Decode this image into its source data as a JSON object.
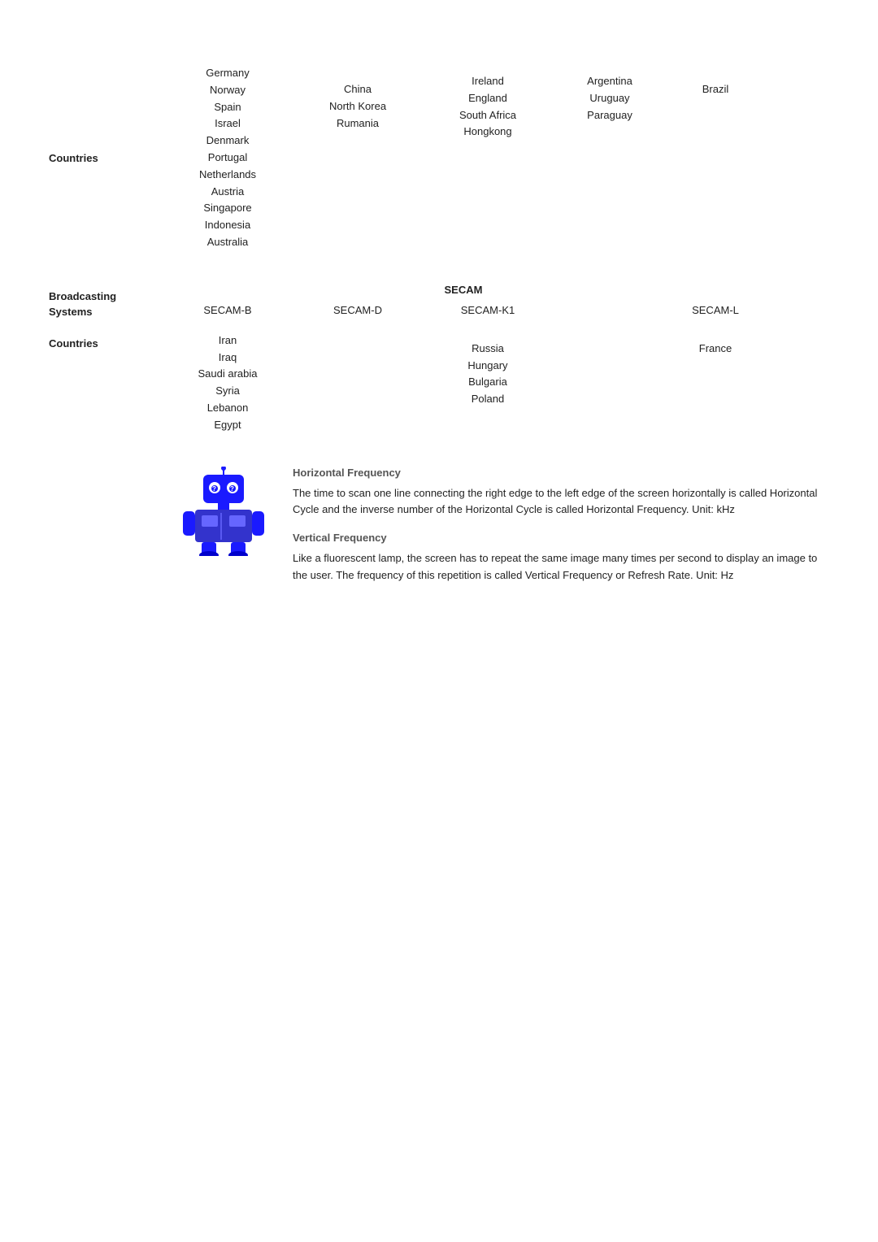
{
  "pal_section": {
    "countries_label": "Countries",
    "col1_countries": "Germany\nNorway\nSpain\nIsrael\nDenmark\nPortugal\nNetherlands\nAustria\nSingapore\nIndonesia\nAustralia",
    "col2_countries": "China\nNorth Korea\nRumania",
    "col3_countries": "Ireland\nEngland\nSouth Africa\nHongkong",
    "col4_countries": "Argentina\nUruguay\nParaguay",
    "col5_countries": "Brazil"
  },
  "secam_section": {
    "broadcasting_systems_label": "Broadcasting\nSystems",
    "secam_title": "SECAM",
    "col1_header": "SECAM-B",
    "col2_header": "SECAM-D",
    "col3_header": "SECAM-K1",
    "col4_header": "SECAM-L",
    "countries_label": "Countries",
    "col1_countries": "Iran\nIraq\nSaudi arabia\nSyria\nLebanon\nEgypt",
    "col2_countries": "",
    "col3_countries": "Russia\nHungary\nBulgaria\nPoland",
    "col4_countries": "France"
  },
  "horizontal_frequency": {
    "title": "Horizontal Frequency",
    "description": "The time to scan one line connecting the right edge to the left edge of the screen horizontally is called Horizontal Cycle and the inverse number of the Horizontal Cycle is called Horizontal Frequency. Unit: kHz"
  },
  "vertical_frequency": {
    "title": "Vertical Frequency",
    "description": "Like a fluorescent lamp, the screen has to repeat the same image many times per second to display an image to the user. The frequency of this repetition is called Vertical Frequency or Refresh Rate. Unit: Hz"
  }
}
